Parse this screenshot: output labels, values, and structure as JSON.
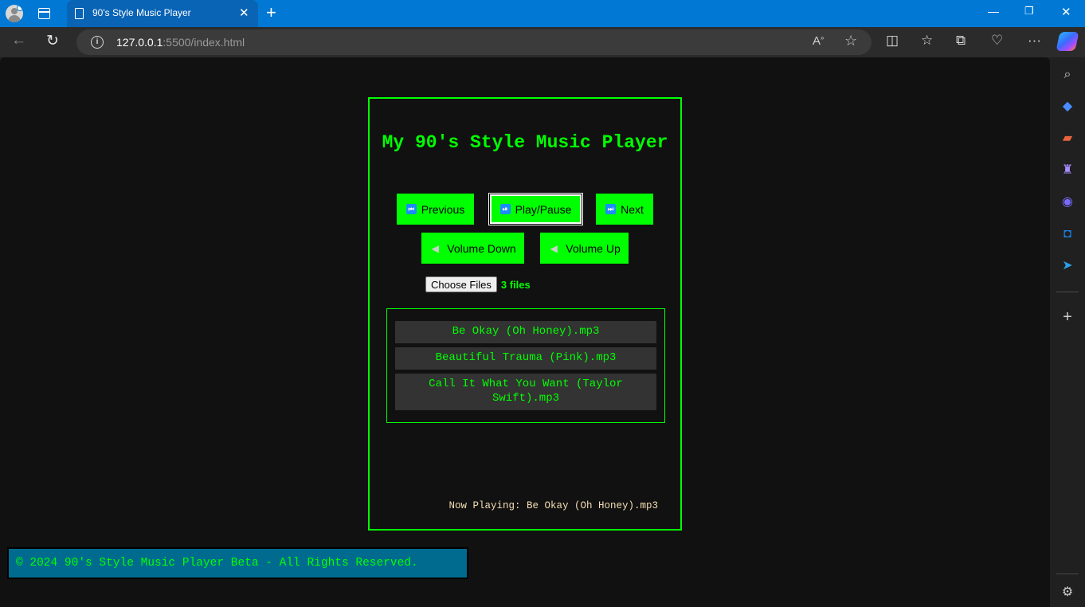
{
  "browser": {
    "tab_title": "90's Style Music Player",
    "url_host": "127.0.0.1",
    "url_path": ":5500/index.html",
    "accent_color": "#0078d4"
  },
  "player": {
    "title": "My 90's Style Music Player",
    "buttons": {
      "previous": "Previous",
      "play_pause": "Play/Pause",
      "next": "Next",
      "volume_down": "Volume Down",
      "volume_up": "Volume Up"
    },
    "file_input": {
      "button_label": "Choose Files",
      "status": "3 files"
    },
    "playlist": [
      "Be Okay (Oh Honey).mp3",
      "Beautiful Trauma (Pink).mp3",
      "Call It What You Want (Taylor Swift).mp3"
    ],
    "now_playing": "Now Playing: Be Okay (Oh Honey).mp3",
    "theme": {
      "accent": "#00ff00",
      "background": "#111111",
      "item_bg": "#333333",
      "now_playing_color": "#f5deb3"
    }
  },
  "footer": {
    "text": "© 2024 90's Style Music Player Beta - All Rights Reserved.",
    "background": "#006b8f"
  }
}
